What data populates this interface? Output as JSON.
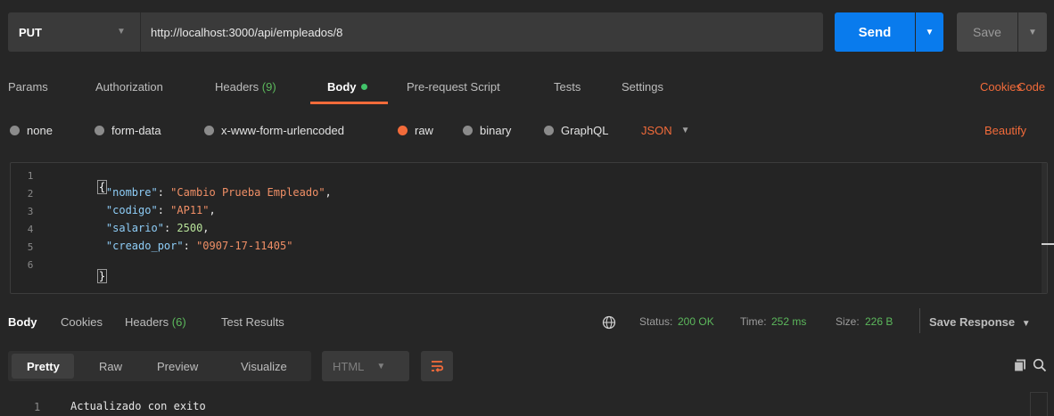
{
  "request": {
    "method": "PUT",
    "url": "http://localhost:3000/api/empleados/8",
    "send_label": "Send",
    "save_label": "Save"
  },
  "request_tabs": {
    "params": "Params",
    "authorization": "Authorization",
    "headers": "Headers",
    "headers_count": "(9)",
    "body": "Body",
    "prerequest": "Pre-request Script",
    "tests": "Tests",
    "settings": "Settings",
    "cookies": "Cookies",
    "code": "Code"
  },
  "body_types": {
    "none": "none",
    "form_data": "form-data",
    "urlencoded": "x-www-form-urlencoded",
    "raw": "raw",
    "binary": "binary",
    "graphql": "GraphQL",
    "selected_raw": "raw",
    "format": "JSON",
    "beautify": "Beautify"
  },
  "editor": {
    "line_numbers": [
      "1",
      "2",
      "3",
      "4",
      "5",
      "6"
    ],
    "open_brace": "{",
    "close_brace": "}",
    "fields": [
      {
        "key": "\"nombre\"",
        "value": "\"Cambio Prueba Empleado\"",
        "trail": ",",
        "type": "string"
      },
      {
        "key": "\"codigo\"",
        "value": "\"AP11\"",
        "trail": ",",
        "type": "string"
      },
      {
        "key": "\"salario\"",
        "value": "2500",
        "trail": ",",
        "type": "number"
      },
      {
        "key": "\"creado_por\"",
        "value": "\"0907-17-11405\"",
        "trail": "",
        "type": "string"
      }
    ]
  },
  "response": {
    "tabs": {
      "body": "Body",
      "cookies": "Cookies",
      "headers": "Headers",
      "headers_count": "(6)",
      "test_results": "Test Results"
    },
    "status_label": "Status:",
    "status_value": "200 OK",
    "time_label": "Time:",
    "time_value": "252 ms",
    "size_label": "Size:",
    "size_value": "226 B",
    "save_response": "Save Response",
    "views": {
      "pretty": "Pretty",
      "raw": "Raw",
      "preview": "Preview",
      "visualize": "Visualize"
    },
    "format": "HTML",
    "line_number": "1",
    "text": "Actualizado con exito"
  },
  "colors": {
    "accent": "#f26b3a",
    "send": "#097bed",
    "status_ok": "#5cb85c"
  },
  "icons": [
    "chevron-down-icon",
    "globe-icon",
    "wrap-lines-icon",
    "copy-icon",
    "search-icon"
  ]
}
